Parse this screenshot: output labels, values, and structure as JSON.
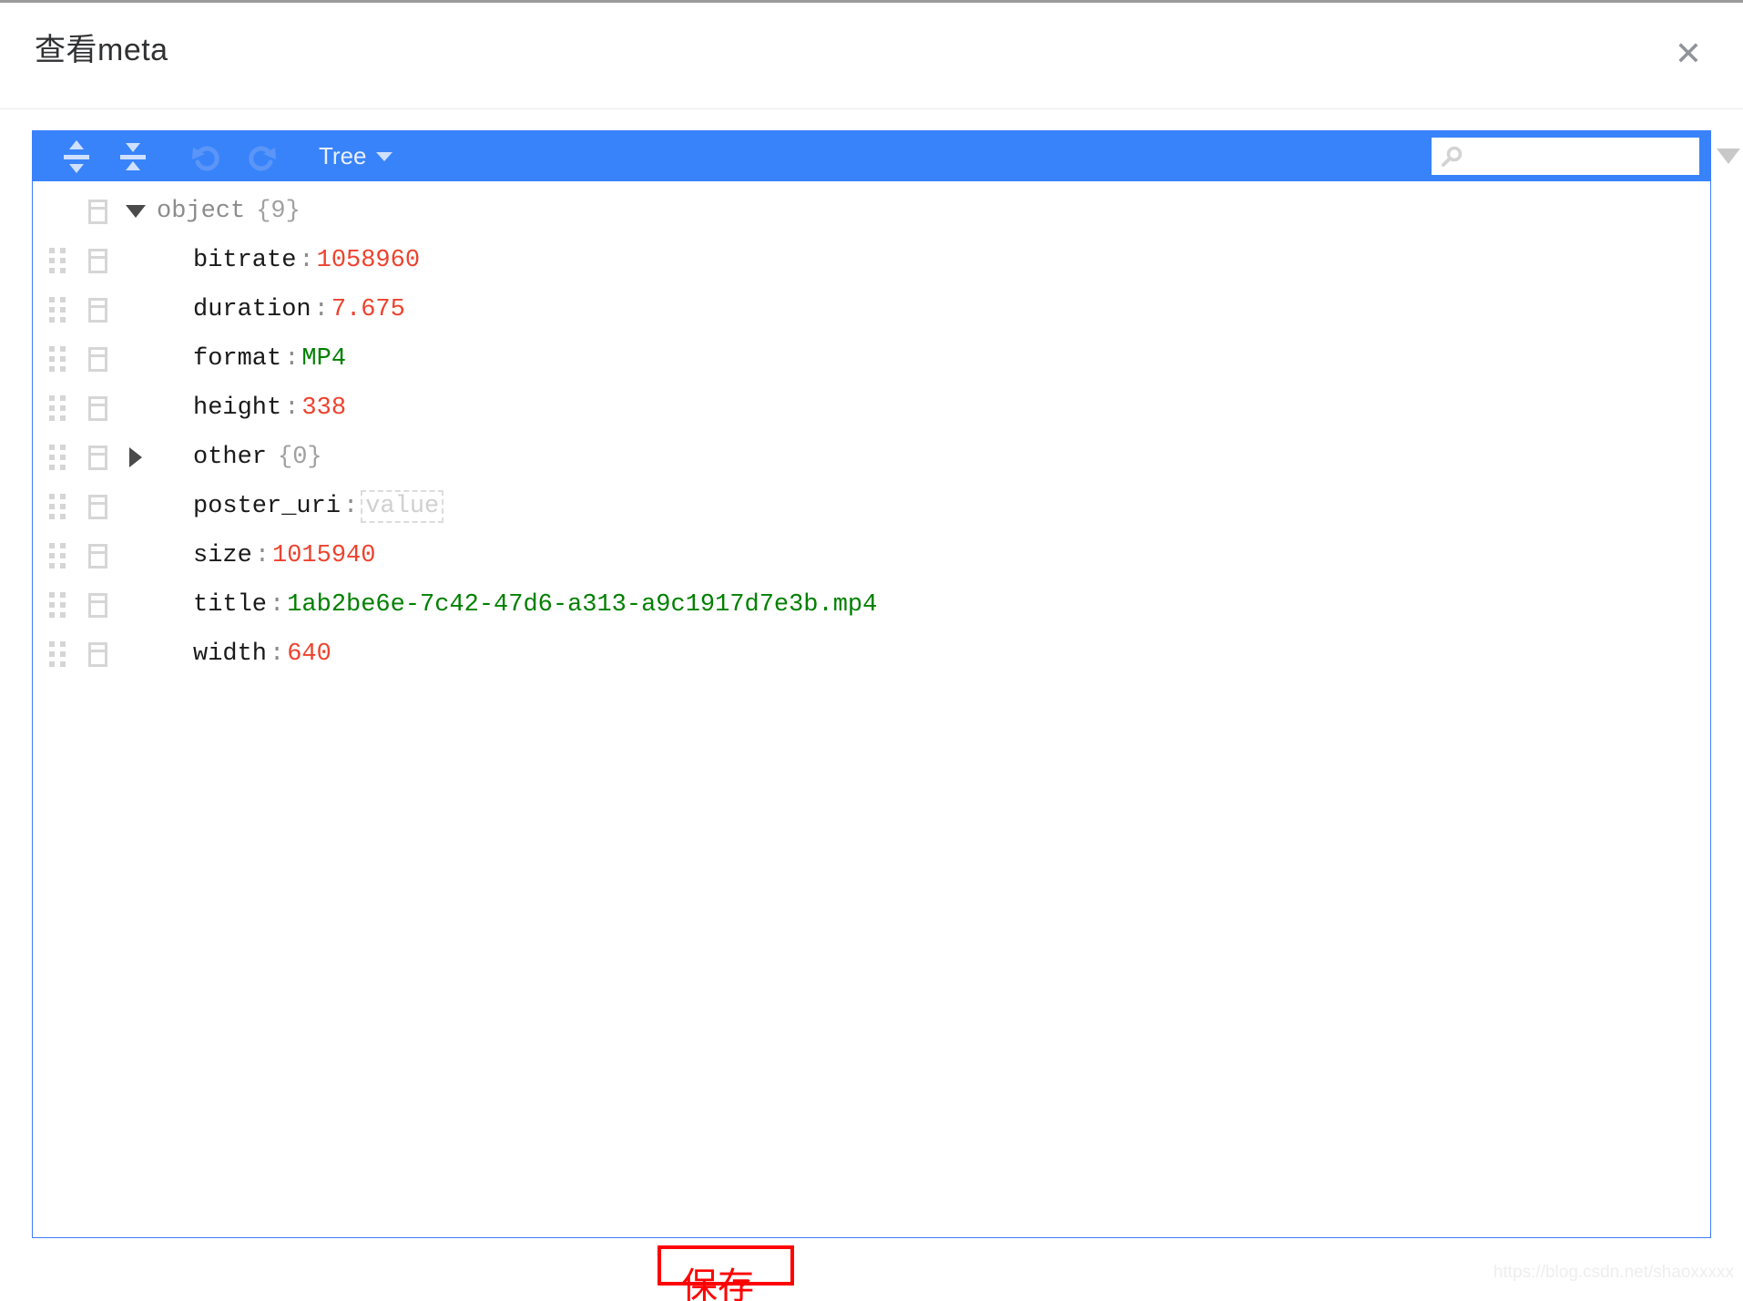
{
  "modal": {
    "title": "查看meta",
    "close_icon": "close-icon"
  },
  "editor": {
    "toolbar": {
      "expand_all_icon": "expand-all-icon",
      "collapse_all_icon": "collapse-all-icon",
      "undo_icon": "undo-icon",
      "redo_icon": "redo-icon",
      "mode_label": "Tree",
      "mode_caret_icon": "chevron-down-icon"
    },
    "search": {
      "icon": "search-icon",
      "value": "",
      "placeholder": "",
      "next_icon": "triangle-down-icon",
      "prev_icon": "triangle-up-icon"
    },
    "tree": {
      "root": {
        "label": "object",
        "count": "{9}",
        "expanded": true
      },
      "rows": [
        {
          "key": "bitrate",
          "sep": ":",
          "value": "1058960",
          "type": "number",
          "expandable": false
        },
        {
          "key": "duration",
          "sep": ":",
          "value": "7.675",
          "type": "number",
          "expandable": false
        },
        {
          "key": "format",
          "sep": ":",
          "value": "MP4",
          "type": "string",
          "expandable": false
        },
        {
          "key": "height",
          "sep": ":",
          "value": "338",
          "type": "number",
          "expandable": false
        },
        {
          "key": "other",
          "sep": "",
          "value": "{0}",
          "type": "container",
          "expandable": true
        },
        {
          "key": "poster_uri",
          "sep": ":",
          "value": "value",
          "type": "empty",
          "expandable": false
        },
        {
          "key": "size",
          "sep": ":",
          "value": "1015940",
          "type": "number",
          "expandable": false
        },
        {
          "key": "title",
          "sep": ":",
          "value": "1ab2be6e-7c42-47d6-a313-a9c1917d7e3b.mp4",
          "type": "string",
          "expandable": false
        },
        {
          "key": "width",
          "sep": ":",
          "value": "640",
          "type": "number",
          "expandable": false
        }
      ]
    }
  },
  "footer": {
    "save_label": "保存",
    "watermark": "https://blog.csdn.net/shaoxxxxx"
  },
  "colors": {
    "accent": "#3883fa",
    "panel_border": "#3d7eff",
    "number": "#ee422e",
    "string": "#008000",
    "annotation": "#ff0000"
  }
}
